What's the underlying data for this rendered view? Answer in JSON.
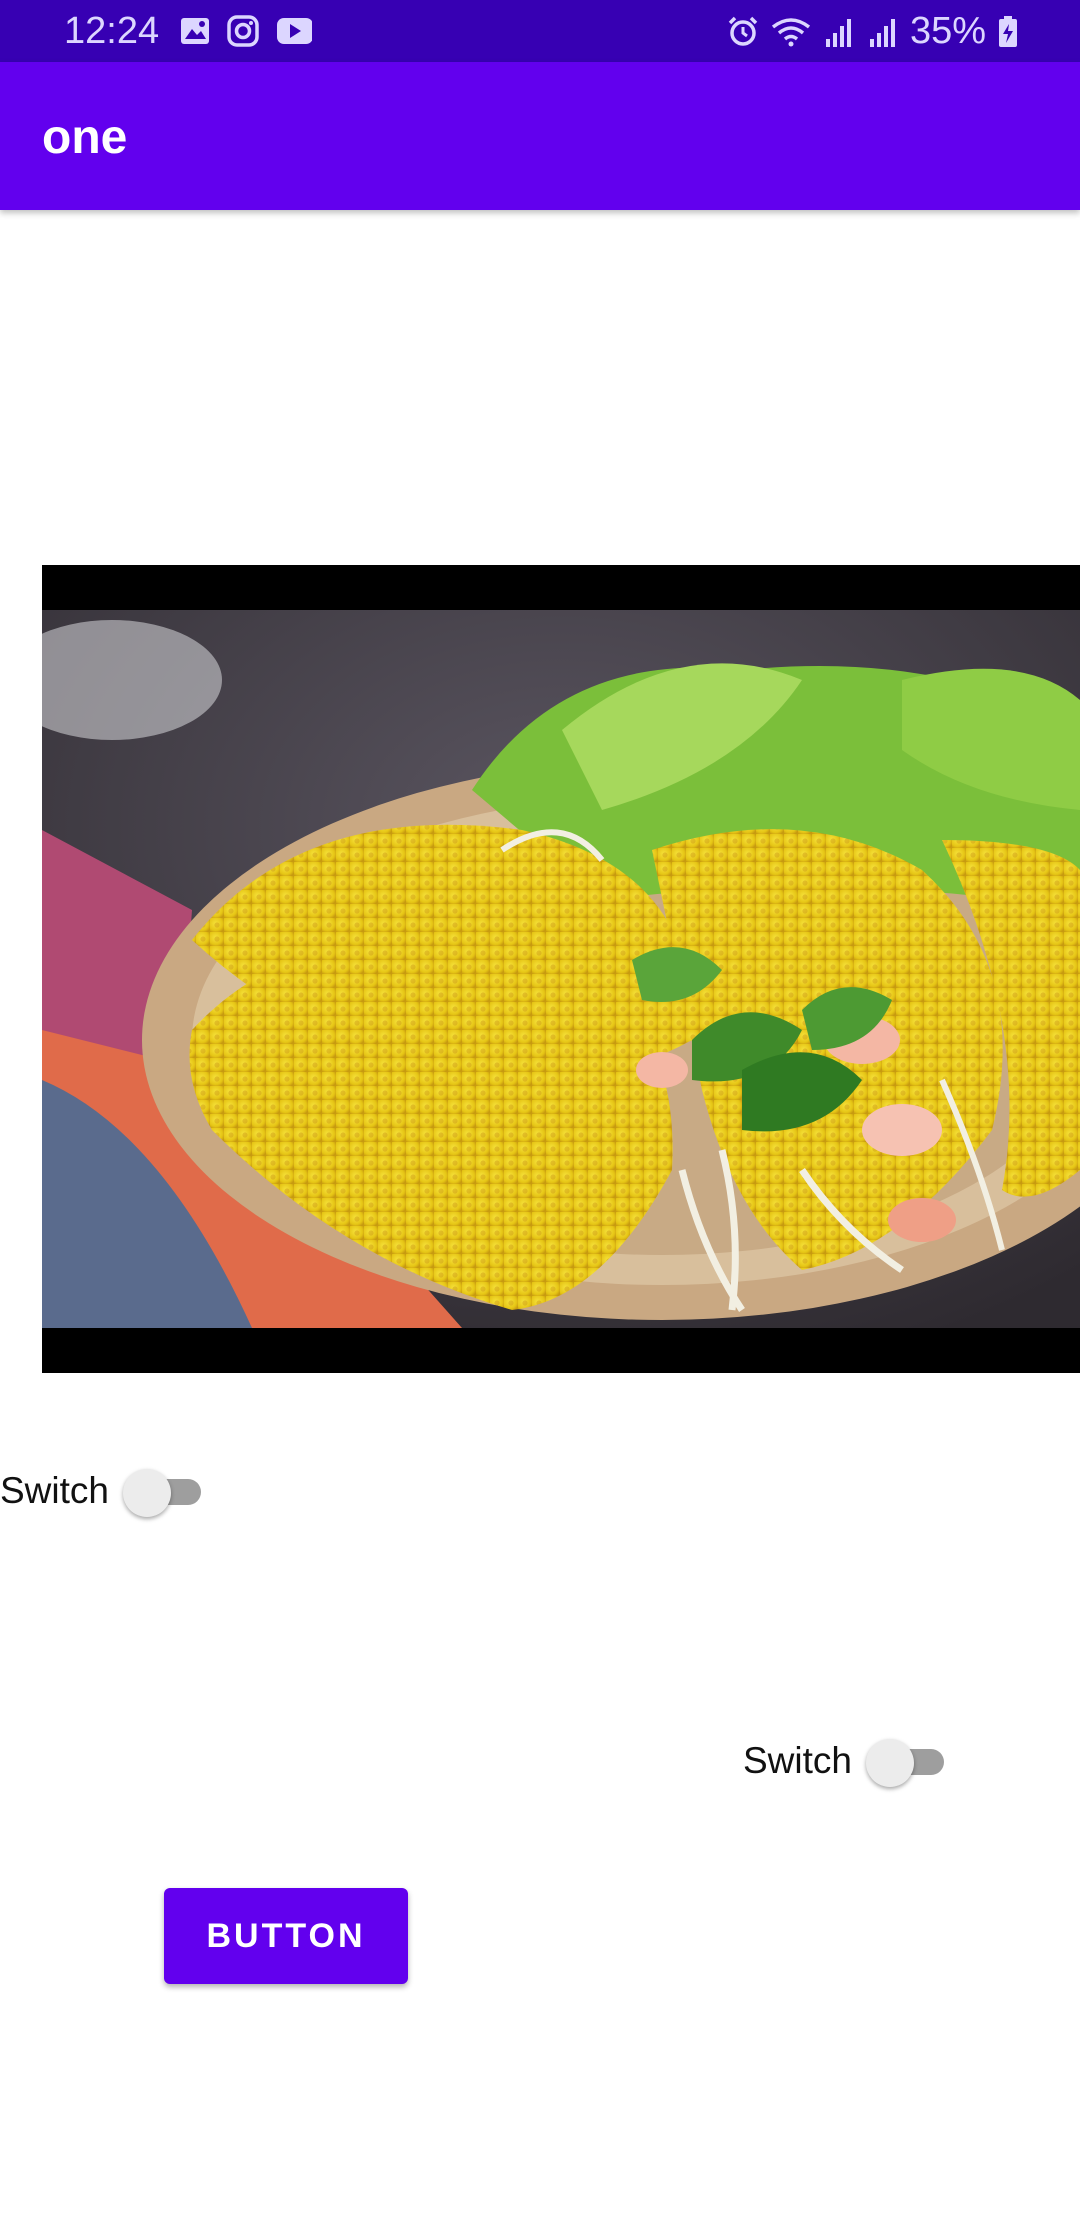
{
  "status_bar": {
    "time": "12:24",
    "battery_percent": "35%",
    "left_icons": [
      "image-icon",
      "instagram-icon",
      "youtube-icon"
    ],
    "right_icons": [
      "alarm-icon",
      "wifi-icon",
      "signal-icon",
      "signal-icon-2",
      "battery-charging-icon"
    ]
  },
  "app_bar": {
    "title": "one",
    "color": "#6200ee"
  },
  "image": {
    "subject": "Vietnamese crispy pancakes (banh xeo) with herbs, shrimp and bean sprouts on a plate"
  },
  "switches": [
    {
      "label": "Switch",
      "checked": false
    },
    {
      "label": "Switch",
      "checked": false
    }
  ],
  "button": {
    "label": "BUTTON",
    "color": "#6200ee"
  }
}
